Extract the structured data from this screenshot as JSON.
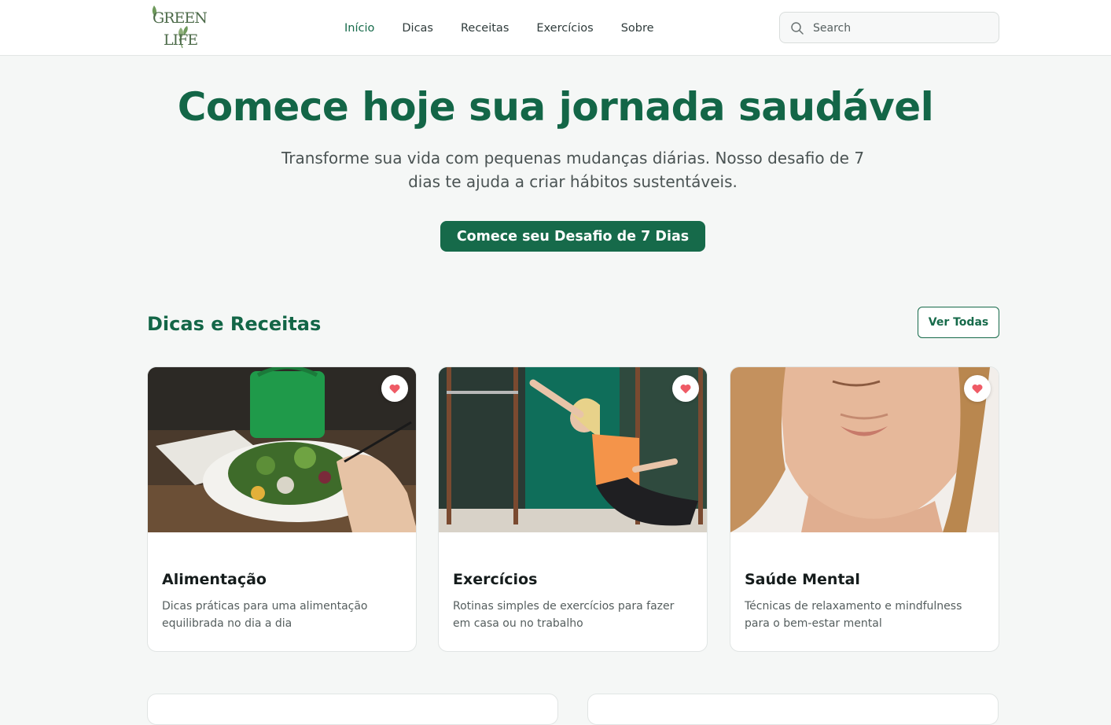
{
  "brand": {
    "logo_line1": "GREEN",
    "logo_line2": "LIFE",
    "accent_color": "#166a4a",
    "logo_color": "#4d6b4a"
  },
  "nav": {
    "items": [
      {
        "label": "Início",
        "active": true
      },
      {
        "label": "Dicas",
        "active": false
      },
      {
        "label": "Receitas",
        "active": false
      },
      {
        "label": "Exercícios",
        "active": false
      },
      {
        "label": "Sobre",
        "active": false
      }
    ]
  },
  "search": {
    "placeholder": "Search",
    "icon": "search-icon"
  },
  "hero": {
    "title": "Comece hoje sua jornada saudável",
    "subtitle": "Transforme sua vida com pequenas mudanças diárias. Nosso desafio de 7 dias te ajuda a criar hábitos sustentáveis.",
    "cta_label": "Comece seu Desafio de 7 Dias"
  },
  "section": {
    "title": "Dicas e Receitas",
    "view_all_label": "Ver Todas"
  },
  "cards": [
    {
      "title": "Alimentação",
      "description": "Dicas práticas para uma alimentação equilibrada no dia a dia",
      "favorite_icon": "heart-icon"
    },
    {
      "title": "Exercícios",
      "description": "Rotinas simples de exercícios para fazer em casa ou no trabalho",
      "favorite_icon": "heart-icon"
    },
    {
      "title": "Saúde Mental",
      "description": "Técnicas de relaxamento e mindfulness para o bem-estar mental",
      "favorite_icon": "heart-icon"
    }
  ]
}
